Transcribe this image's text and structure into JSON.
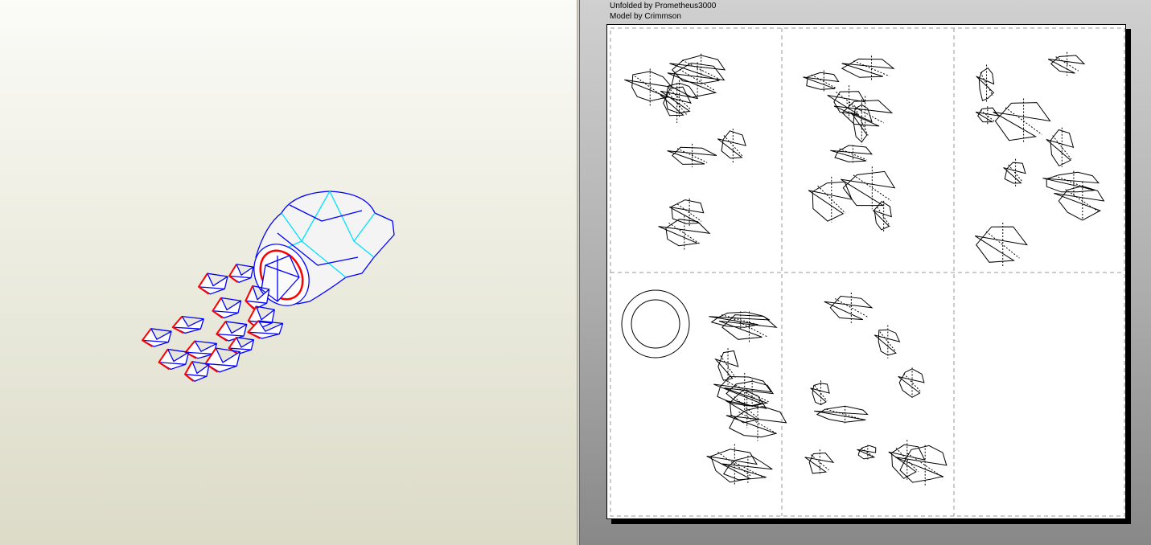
{
  "view2d": {
    "credits": [
      "Unfolded by Prometheus3000",
      "Model by Crimmson"
    ]
  },
  "colors": {
    "edge": "#0000ff",
    "fold": "#00e0ff",
    "cut": "#ff0000"
  }
}
